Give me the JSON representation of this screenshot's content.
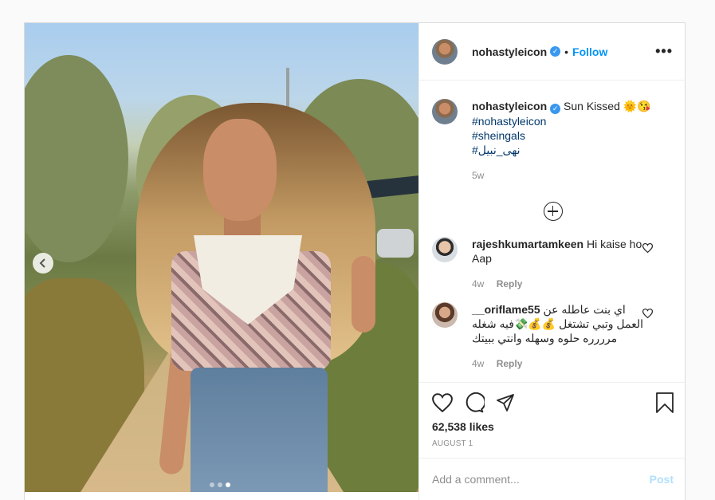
{
  "post": {
    "username": "nohastyleicon",
    "verified_mark": "✓",
    "follow_label": "Follow",
    "bullet": "•",
    "more_label": "•••",
    "caption": {
      "text": "Sun Kissed",
      "emoji": "🌞😘",
      "hashtags": [
        "#nohastyleicon",
        "#sheingals",
        "#نهى_نبيل"
      ],
      "age": "5w"
    },
    "comments": [
      {
        "username": "rajeshkumartamkeen",
        "text": "Hi kaise ho Aap",
        "age": "4w",
        "reply_label": "Reply"
      },
      {
        "username": "__oriflame55",
        "text": "اي بنت عاطله عن العمل وتبي تشتغل 💰💰💸فيه شغله مرررره حلوه وسهله وانتي ببيتك",
        "age": "4w",
        "reply_label": "Reply"
      }
    ],
    "likes": "62,538 likes",
    "date": "AUGUST 1",
    "comment_placeholder": "Add a comment...",
    "post_button": "Post",
    "carousel": {
      "count": 3,
      "active_index": 2
    }
  },
  "icons": [
    "chevron-left-icon",
    "verified-icon",
    "more-icon",
    "load-more-icon",
    "heart-icon",
    "comment-icon",
    "share-icon",
    "bookmark-icon"
  ],
  "colors": {
    "accent": "#0095f6",
    "hashtag": "#00376b",
    "muted": "#8e8e8e",
    "post_disabled": "#b2dffc"
  }
}
